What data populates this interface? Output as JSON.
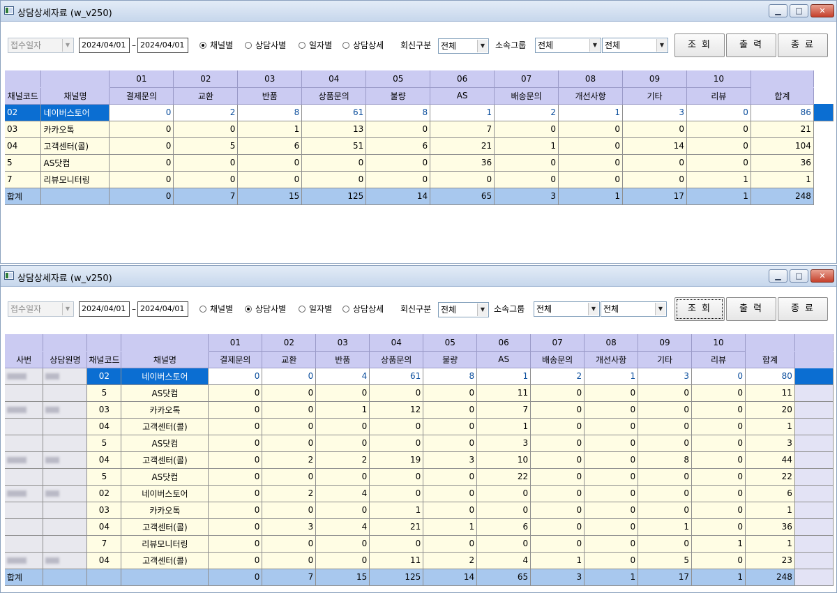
{
  "columns": [
    {
      "code": "01",
      "name": "결제문의"
    },
    {
      "code": "02",
      "name": "교환"
    },
    {
      "code": "03",
      "name": "반품"
    },
    {
      "code": "04",
      "name": "상품문의"
    },
    {
      "code": "05",
      "name": "불량"
    },
    {
      "code": "06",
      "name": "AS"
    },
    {
      "code": "07",
      "name": "배송문의"
    },
    {
      "code": "08",
      "name": "개선사항"
    },
    {
      "code": "09",
      "name": "기타"
    },
    {
      "code": "10",
      "name": "리뷰"
    }
  ],
  "window1": {
    "title": "상담상세자료 (w_v250)",
    "date_type": "접수일자",
    "date_from": "2024/04/01",
    "date_to": "2024/04/01",
    "date_sep": "–",
    "radios": [
      {
        "label": "채널별",
        "checked": true
      },
      {
        "label": "상담사별",
        "checked": false
      },
      {
        "label": "일자별",
        "checked": false
      },
      {
        "label": "상담상세",
        "checked": false
      }
    ],
    "reply_label": "회신구분",
    "reply_value": "전체",
    "group_label": "소속그룹",
    "group_value1": "전체",
    "group_value2": "전체",
    "btn_search": "조 회",
    "btn_print": "출 력",
    "btn_exit": "종 료",
    "grid": {
      "h_code": "채널코드",
      "h_name": "채널명",
      "h_total": "합계",
      "rows": [
        {
          "code": "02",
          "name": "네이버스토어",
          "v": [
            0,
            2,
            8,
            61,
            8,
            1,
            2,
            1,
            3,
            0
          ],
          "total": 86
        },
        {
          "code": "03",
          "name": "카카오톡",
          "v": [
            0,
            0,
            1,
            13,
            0,
            7,
            0,
            0,
            0,
            0
          ],
          "total": 21
        },
        {
          "code": "04",
          "name": "고객센터(콜)",
          "v": [
            0,
            5,
            6,
            51,
            6,
            21,
            1,
            0,
            14,
            0
          ],
          "total": 104
        },
        {
          "code": "5",
          "name": "AS닷컴",
          "v": [
            0,
            0,
            0,
            0,
            0,
            36,
            0,
            0,
            0,
            0
          ],
          "total": 36
        },
        {
          "code": "7",
          "name": "리뷰모니터링",
          "v": [
            0,
            0,
            0,
            0,
            0,
            0,
            0,
            0,
            0,
            1
          ],
          "total": 1
        }
      ],
      "total_row": {
        "label": "합계",
        "v": [
          0,
          7,
          15,
          125,
          14,
          65,
          3,
          1,
          17,
          1
        ],
        "total": 248
      }
    }
  },
  "window2": {
    "title": "상담상세자료 (w_v250)",
    "date_type": "접수일자",
    "date_from": "2024/04/01",
    "date_to": "2024/04/01",
    "date_sep": "–",
    "radios": [
      {
        "label": "채널별",
        "checked": false
      },
      {
        "label": "상담사별",
        "checked": true
      },
      {
        "label": "일자별",
        "checked": false
      },
      {
        "label": "상담상세",
        "checked": false
      }
    ],
    "reply_label": "회신구분",
    "reply_value": "전체",
    "group_label": "소속그룹",
    "group_value1": "전체",
    "group_value2": "전체",
    "btn_search": "조 회",
    "btn_print": "출 력",
    "btn_exit": "종 료",
    "grid": {
      "h_emp": "사번",
      "h_agent": "상담원명",
      "h_code": "채널코드",
      "h_name": "채널명",
      "h_total": "합계",
      "rows": [
        {
          "code": "02",
          "name": "네이버스토어",
          "v": [
            0,
            0,
            4,
            61,
            8,
            1,
            2,
            1,
            3,
            0
          ],
          "total": 80
        },
        {
          "code": "5",
          "name": "AS닷컴",
          "v": [
            0,
            0,
            0,
            0,
            0,
            11,
            0,
            0,
            0,
            0
          ],
          "total": 11
        },
        {
          "code": "03",
          "name": "카카오톡",
          "v": [
            0,
            0,
            1,
            12,
            0,
            7,
            0,
            0,
            0,
            0
          ],
          "total": 20
        },
        {
          "code": "04",
          "name": "고객센터(콜)",
          "v": [
            0,
            0,
            0,
            0,
            0,
            1,
            0,
            0,
            0,
            0
          ],
          "total": 1
        },
        {
          "code": "5",
          "name": "AS닷컴",
          "v": [
            0,
            0,
            0,
            0,
            0,
            3,
            0,
            0,
            0,
            0
          ],
          "total": 3
        },
        {
          "code": "04",
          "name": "고객센터(콜)",
          "v": [
            0,
            2,
            2,
            19,
            3,
            10,
            0,
            0,
            8,
            0
          ],
          "total": 44
        },
        {
          "code": "5",
          "name": "AS닷컴",
          "v": [
            0,
            0,
            0,
            0,
            0,
            22,
            0,
            0,
            0,
            0
          ],
          "total": 22
        },
        {
          "code": "02",
          "name": "네이버스토어",
          "v": [
            0,
            2,
            4,
            0,
            0,
            0,
            0,
            0,
            0,
            0
          ],
          "total": 6
        },
        {
          "code": "03",
          "name": "카카오톡",
          "v": [
            0,
            0,
            0,
            1,
            0,
            0,
            0,
            0,
            0,
            0
          ],
          "total": 1
        },
        {
          "code": "04",
          "name": "고객센터(콜)",
          "v": [
            0,
            3,
            4,
            21,
            1,
            6,
            0,
            0,
            1,
            0
          ],
          "total": 36
        },
        {
          "code": "7",
          "name": "리뷰모니터링",
          "v": [
            0,
            0,
            0,
            0,
            0,
            0,
            0,
            0,
            0,
            1
          ],
          "total": 1
        },
        {
          "code": "04",
          "name": "고객센터(콜)",
          "v": [
            0,
            0,
            0,
            11,
            2,
            4,
            1,
            0,
            5,
            0
          ],
          "total": 23
        }
      ],
      "total_row": {
        "label": "합계",
        "v": [
          0,
          7,
          15,
          125,
          14,
          65,
          3,
          1,
          17,
          1
        ],
        "total": 248
      }
    }
  }
}
